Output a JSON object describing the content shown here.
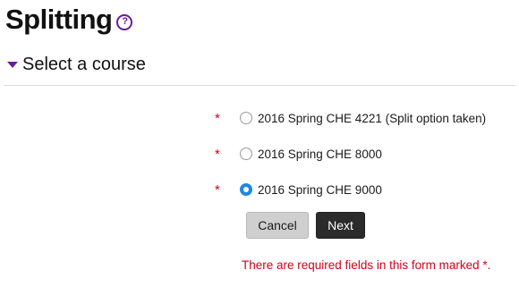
{
  "page": {
    "title": "Splitting",
    "help_icon_glyph": "?"
  },
  "section": {
    "title": "Select a course",
    "expanded": true
  },
  "form": {
    "required_marker": "*",
    "options": [
      {
        "label": "2016 Spring CHE 4221 (Split option taken)",
        "selected": false
      },
      {
        "label": "2016 Spring CHE 8000",
        "selected": false
      },
      {
        "label": "2016 Spring CHE 9000",
        "selected": true
      }
    ],
    "buttons": {
      "cancel_label": "Cancel",
      "next_label": "Next"
    },
    "required_note": "There are required fields in this form marked *."
  },
  "colors": {
    "accent_purple": "#6a1b9a",
    "required_red": "#d0021b",
    "radio_selected_blue": "#1e88e5",
    "next_button_bg": "#2b2b2b",
    "cancel_button_bg": "#cfcfcf"
  },
  "icons": {
    "help": "help-icon",
    "collapse": "triangle-down-icon"
  }
}
